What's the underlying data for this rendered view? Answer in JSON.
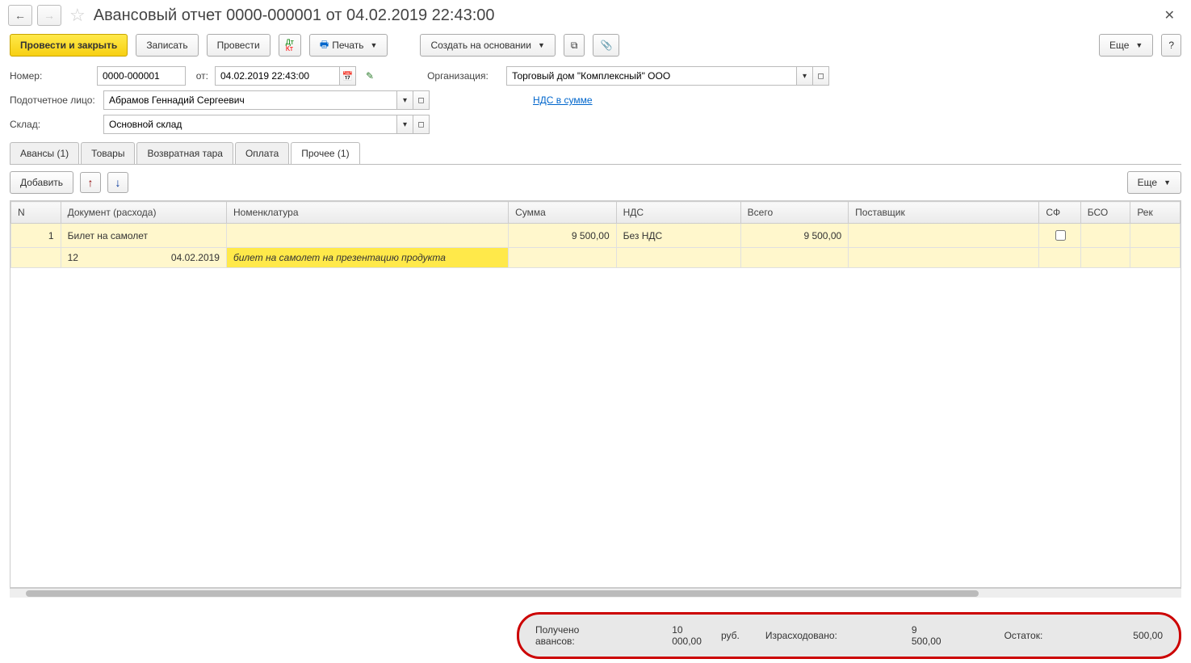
{
  "header": {
    "title": "Авансовый отчет 0000-000001 от 04.02.2019 22:43:00"
  },
  "toolbar": {
    "post_close": "Провести и закрыть",
    "save": "Записать",
    "post": "Провести",
    "print": "Печать",
    "create_based": "Создать на основании",
    "more": "Еще",
    "help": "?"
  },
  "form": {
    "number_label": "Номер:",
    "number": "0000-000001",
    "from_label": "от:",
    "date": "04.02.2019 22:43:00",
    "org_label": "Организация:",
    "org": "Торговый дом \"Комплексный\" ООО",
    "person_label": "Подотчетное лицо:",
    "person": "Абрамов Геннадий Сергеевич",
    "vat_link": "НДС в сумме",
    "warehouse_label": "Склад:",
    "warehouse": "Основной склад"
  },
  "tabs": {
    "advances": "Авансы (1)",
    "goods": "Товары",
    "packaging": "Возвратная тара",
    "payment": "Оплата",
    "other": "Прочее (1)"
  },
  "tabToolbar": {
    "add": "Добавить",
    "more": "Еще"
  },
  "columns": {
    "n": "N",
    "doc": "Документ (расхода)",
    "nomen": "Номенклатура",
    "sum": "Сумма",
    "vat": "НДС",
    "total": "Всего",
    "supplier": "Поставщик",
    "sf": "СФ",
    "bso": "БСО",
    "rek": "Рек"
  },
  "row": {
    "n": "1",
    "doc": "Билет на самолет",
    "sum": "9 500,00",
    "vat": "Без НДС",
    "total": "9 500,00",
    "sub_num": "12",
    "sub_date": "04.02.2019",
    "sub_desc": "билет на самолет на презентацию продукта"
  },
  "footer": {
    "received_label": "Получено авансов:",
    "received": "10 000,00",
    "cur": "руб.",
    "spent_label": "Израсходовано:",
    "spent": "9 500,00",
    "balance_label": "Остаток:",
    "balance": "500,00"
  }
}
